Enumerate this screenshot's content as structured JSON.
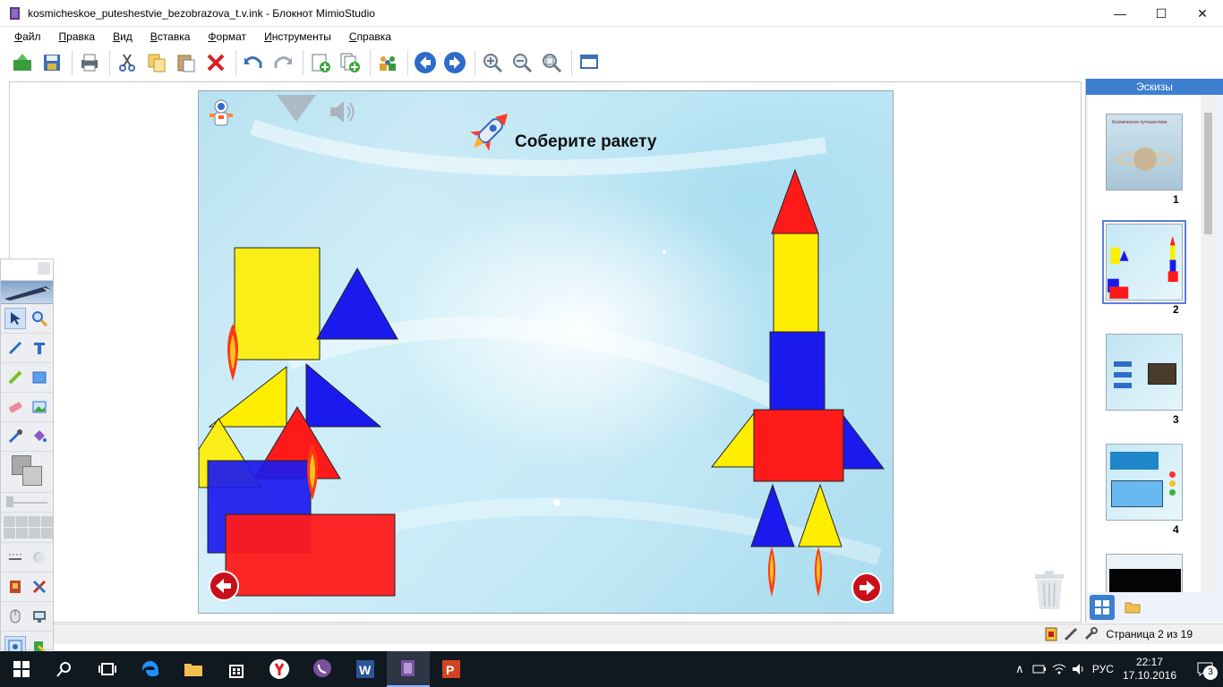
{
  "window": {
    "title": "kosmicheskoe_puteshestvie_bezobrazova_t.v.ink - Блокнот MimioStudio",
    "minimize": "—",
    "maximize": "☐",
    "close": "✕"
  },
  "menu": [
    {
      "label": "Файл",
      "key": "Ф",
      "rest": "айл"
    },
    {
      "label": "Правка",
      "key": "П",
      "rest": "равка"
    },
    {
      "label": "Вид",
      "key": "В",
      "rest": "ид"
    },
    {
      "label": "Вставка",
      "key": "В",
      "rest": "ставка"
    },
    {
      "label": "Формат",
      "key": "Ф",
      "rest": "ормат"
    },
    {
      "label": "Инструменты",
      "key": "И",
      "rest": "нструменты"
    },
    {
      "label": "Справка",
      "key": "С",
      "rest": "правка"
    }
  ],
  "slide": {
    "title": "Соберите ракету"
  },
  "thumbnails": {
    "header": "Эскизы",
    "items": [
      {
        "num": "1",
        "caption": "Космическое путешествие"
      },
      {
        "num": "2",
        "caption": ""
      },
      {
        "num": "3",
        "caption": ""
      },
      {
        "num": "4",
        "caption": ""
      }
    ]
  },
  "status": {
    "page": "Страница 2 из 19"
  },
  "taskbar": {
    "language": "РУС",
    "time": "22:17",
    "date": "17.10.2016",
    "notifications": "3"
  },
  "colors": {
    "red": "#ff1a1a",
    "blue": "#1a1aee",
    "yellow": "#ffee00",
    "accent": "#3f7fd0"
  }
}
